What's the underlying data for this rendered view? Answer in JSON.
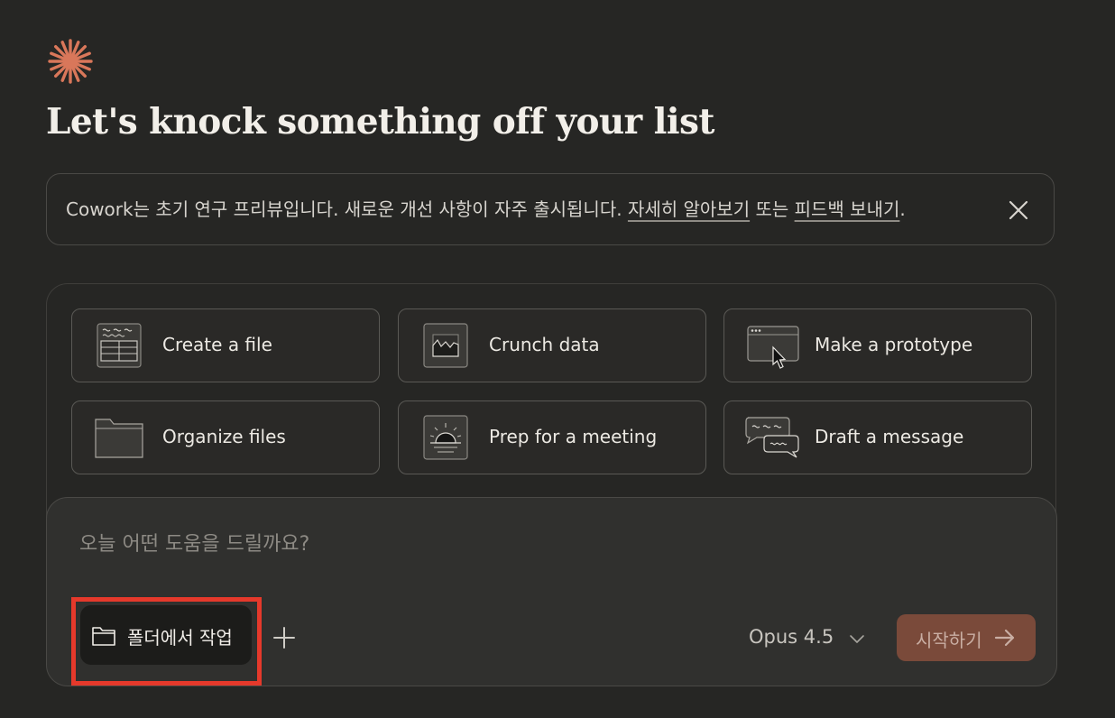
{
  "header": {
    "logo_icon": "claude-starburst-icon",
    "title": "Let's knock something off your list"
  },
  "notice": {
    "text": "Cowork는 초기 연구 프리뷰입니다. 새로운 개선 사항이 자주 출시됩니다. ",
    "learn_more_link": "자세히 알아보기",
    "connector": " 또는 ",
    "feedback_link": "피드백 보내기",
    "end": ".",
    "close_icon": "close-icon"
  },
  "tasks": [
    {
      "label": "Create a file",
      "icon": "spreadsheet-file-icon"
    },
    {
      "label": "Crunch data",
      "icon": "area-chart-icon"
    },
    {
      "label": "Make a prototype",
      "icon": "browser-window-cursor-icon"
    },
    {
      "label": "Organize files",
      "icon": "folder-icon"
    },
    {
      "label": "Prep for a meeting",
      "icon": "sunrise-calendar-icon"
    },
    {
      "label": "Draft a message",
      "icon": "chat-bubbles-icon"
    }
  ],
  "composer": {
    "placeholder": "오늘 어떤 도움을 드릴까요?",
    "folder_button_label": "폴더에서 작업",
    "folder_icon": "folder-icon",
    "add_icon": "plus-icon",
    "model_label": "Opus 4.5",
    "model_chevron_icon": "chevron-down-icon",
    "start_button_label": "시작하기",
    "start_arrow_icon": "arrow-right-icon"
  },
  "colors": {
    "background": "#262624",
    "accent": "#d9775a",
    "start_button": "#7a4a3a",
    "highlight": "#e5392b"
  }
}
